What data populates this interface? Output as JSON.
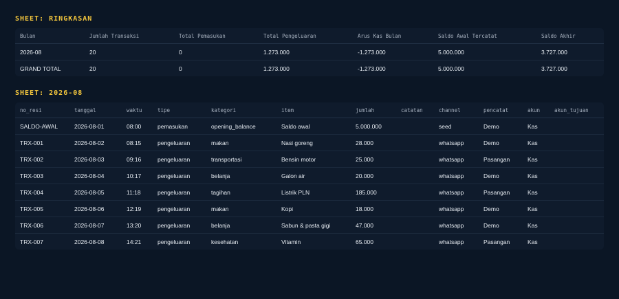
{
  "summary": {
    "title": "SHEET: RINGKASAN",
    "columns": [
      "Bulan",
      "Jumlah Transaksi",
      "Total Pemasukan",
      "Total Pengeluaran",
      "Arus Kas Bulan",
      "Saldo Awal Tercatat",
      "Saldo Akhir"
    ],
    "rows": [
      [
        "2026-08",
        "20",
        "0",
        "1.273.000",
        "-1.273.000",
        "5.000.000",
        "3.727.000"
      ],
      [
        "GRAND TOTAL",
        "20",
        "0",
        "1.273.000",
        "-1.273.000",
        "5.000.000",
        "3.727.000"
      ]
    ]
  },
  "month": {
    "title": "SHEET: 2026-08",
    "columns": [
      "no_resi",
      "tanggal",
      "waktu",
      "tipe",
      "kategori",
      "item",
      "jumlah",
      "catatan",
      "channel",
      "pencatat",
      "akun",
      "akun_tujuan"
    ],
    "rows": [
      [
        "SALDO-AWAL",
        "2026-08-01",
        "08:00",
        "pemasukan",
        "opening_balance",
        "Saldo awal",
        "5.000.000",
        "",
        "seed",
        "Demo",
        "Kas",
        ""
      ],
      [
        "TRX-001",
        "2026-08-02",
        "08:15",
        "pengeluaran",
        "makan",
        "Nasi goreng",
        "28.000",
        "",
        "whatsapp",
        "Demo",
        "Kas",
        ""
      ],
      [
        "TRX-002",
        "2026-08-03",
        "09:16",
        "pengeluaran",
        "transportasi",
        "Bensin motor",
        "25.000",
        "",
        "whatsapp",
        "Pasangan",
        "Kas",
        ""
      ],
      [
        "TRX-003",
        "2026-08-04",
        "10:17",
        "pengeluaran",
        "belanja",
        "Galon air",
        "20.000",
        "",
        "whatsapp",
        "Demo",
        "Kas",
        ""
      ],
      [
        "TRX-004",
        "2026-08-05",
        "11:18",
        "pengeluaran",
        "tagihan",
        "Listrik PLN",
        "185.000",
        "",
        "whatsapp",
        "Pasangan",
        "Kas",
        ""
      ],
      [
        "TRX-005",
        "2026-08-06",
        "12:19",
        "pengeluaran",
        "makan",
        "Kopi",
        "18.000",
        "",
        "whatsapp",
        "Demo",
        "Kas",
        ""
      ],
      [
        "TRX-006",
        "2026-08-07",
        "13:20",
        "pengeluaran",
        "belanja",
        "Sabun & pasta gigi",
        "47.000",
        "",
        "whatsapp",
        "Demo",
        "Kas",
        ""
      ],
      [
        "TRX-007",
        "2026-08-08",
        "14:21",
        "pengeluaran",
        "kesehatan",
        "Vitamin",
        "65.000",
        "",
        "whatsapp",
        "Pasangan",
        "Kas",
        ""
      ]
    ]
  }
}
